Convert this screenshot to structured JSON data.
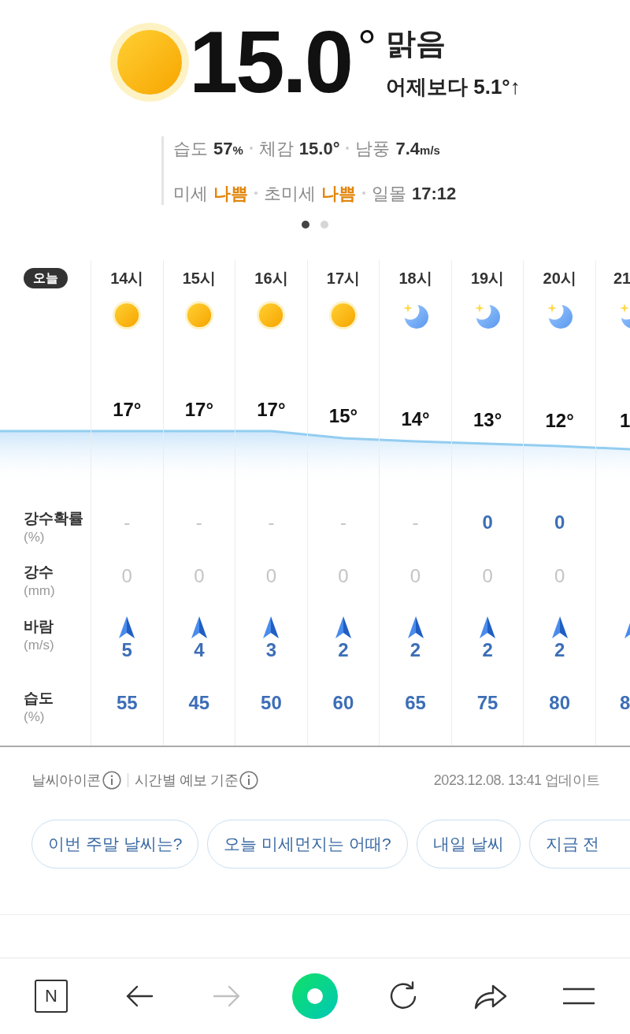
{
  "current": {
    "temp": "15.0$^{°}$",
    "condition": "맑음",
    "comparison": "어제보다 5.1°↑"
  },
  "details": [
    [
      {
        "label": "습도",
        "value": "57",
        "unit": "%",
        "color": "#333333"
      },
      {
        "label": "체감",
        "value": "15.0°",
        "color": "#333333"
      },
      {
        "label": "남풍",
        "value": "7.4",
        "unit": "m/s",
        "color": "#333333"
      }
    ],
    [
      {
        "label": "미세",
        "value": "나쁨",
        "color": "#e2850c"
      },
      {
        "label": "초미세",
        "value": "나쁨",
        "color": "#e2850c"
      },
      {
        "label": "일몰",
        "value": "17:12",
        "color": "#333333"
      }
    ]
  ],
  "pager": [
    {
      "selected": true
    },
    {
      "selected": false
    }
  ],
  "hourly": {
    "badge": "오늘",
    "rows": [
      {
        "kind": "plain",
        "label": "강수확률",
        "unit": "(%)"
      },
      {
        "kind": "plain",
        "label": "강수",
        "unit": "(mm)"
      },
      {
        "kind": "wind",
        "label": "바람",
        "unit": "(m/s)"
      },
      {
        "kind": "plain",
        "label": "습도",
        "unit": "(%)"
      }
    ],
    "hours": [
      {
        "time": "14시",
        "kind": "day",
        "clipped": false,
        "temp": "17°",
        "chance": {
          "text": "-",
          "muted": true
        },
        "rainfall": {
          "text": "0",
          "muted": true
        },
        "wind": {
          "text": "5",
          "muted": false
        },
        "humidity": {
          "text": "55",
          "muted": false
        }
      },
      {
        "time": "15시",
        "kind": "day",
        "clipped": false,
        "temp": "17°",
        "chance": {
          "text": "-",
          "muted": true
        },
        "rainfall": {
          "text": "0",
          "muted": true
        },
        "wind": {
          "text": "4",
          "muted": false
        },
        "humidity": {
          "text": "45",
          "muted": false
        }
      },
      {
        "time": "16시",
        "kind": "day",
        "clipped": false,
        "temp": "17°",
        "chance": {
          "text": "-",
          "muted": true
        },
        "rainfall": {
          "text": "0",
          "muted": true
        },
        "wind": {
          "text": "3",
          "muted": false
        },
        "humidity": {
          "text": "50",
          "muted": false
        }
      },
      {
        "time": "17시",
        "kind": "day",
        "clipped": false,
        "temp": "15°",
        "chance": {
          "text": "-",
          "muted": true
        },
        "rainfall": {
          "text": "0",
          "muted": true
        },
        "wind": {
          "text": "2",
          "muted": false
        },
        "humidity": {
          "text": "60",
          "muted": false
        }
      },
      {
        "time": "18시",
        "kind": "night",
        "clipped": false,
        "temp": "14°",
        "chance": {
          "text": "-",
          "muted": true
        },
        "rainfall": {
          "text": "0",
          "muted": true
        },
        "wind": {
          "text": "2",
          "muted": false
        },
        "humidity": {
          "text": "65",
          "muted": false
        }
      },
      {
        "time": "19시",
        "kind": "night",
        "clipped": false,
        "temp": "13°",
        "chance": {
          "text": "0",
          "muted": false
        },
        "rainfall": {
          "text": "0",
          "muted": true
        },
        "wind": {
          "text": "2",
          "muted": false
        },
        "humidity": {
          "text": "75",
          "muted": false
        }
      },
      {
        "time": "20시",
        "kind": "night",
        "clipped": false,
        "temp": "12°",
        "chance": {
          "text": "0",
          "muted": false
        },
        "rainfall": {
          "text": "0",
          "muted": true
        },
        "wind": {
          "text": "2",
          "muted": false
        },
        "humidity": {
          "text": "80",
          "muted": false
        }
      },
      {
        "time": "21",
        "kind": "night",
        "clipped": true,
        "temp": "1",
        "humidity": {
          "text": "8",
          "muted": false
        }
      }
    ]
  },
  "footer": {
    "links": [
      "날씨아이콘",
      "시간별 예보 기준"
    ],
    "updated": "2023.12.08. 13:41 업데이트"
  },
  "suggestions": [
    {
      "text": "이번 주말 날씨는?",
      "clipped": false
    },
    {
      "text": "오늘 미세먼지는 어때?",
      "clipped": false
    },
    {
      "text": "내일 날씨",
      "clipped": false
    },
    {
      "text": "지금 전",
      "clipped": true
    }
  ],
  "toolbar": [
    {
      "kind": "logo",
      "text": "N",
      "disabled": false
    },
    {
      "kind": "back",
      "disabled": false
    },
    {
      "kind": "forward",
      "disabled": true
    },
    {
      "kind": "ring",
      "disabled": false
    },
    {
      "kind": "reload",
      "disabled": false
    },
    {
      "kind": "share",
      "disabled": false
    },
    {
      "kind": "menu",
      "disabled": false
    }
  ]
}
